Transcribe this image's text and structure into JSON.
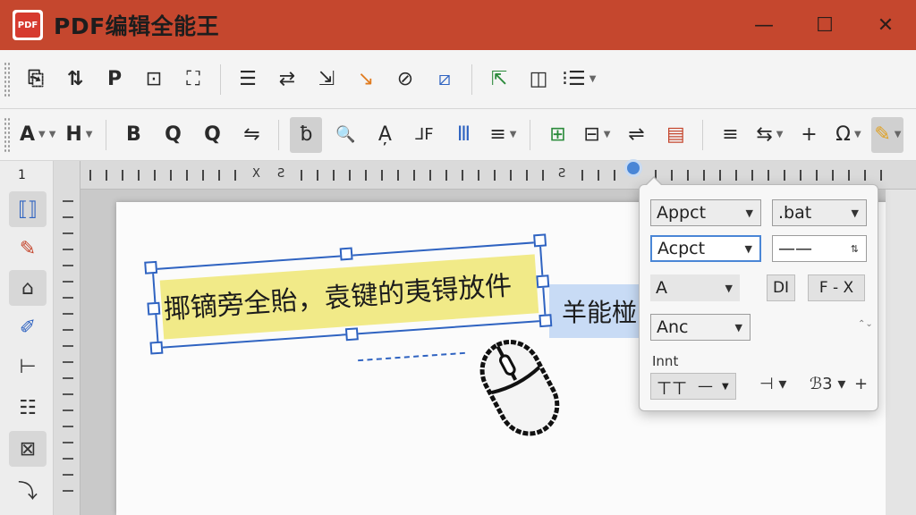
{
  "window": {
    "logo_text": "PDF",
    "title": "PDF编辑全能王",
    "minimize": "—",
    "maximize": "☐",
    "close": "✕"
  },
  "toolbar1": [
    "⎘",
    "⇅",
    "P",
    "⊡",
    "⛶",
    "☰",
    "⇄",
    "⇲",
    "↘",
    "⊘",
    "⧄",
    "⇱",
    "◫",
    "⁝☰"
  ],
  "toolbar2": {
    "font": "A",
    "heading": "H",
    "bold": "B",
    "find": "Q",
    "find2": "Q",
    "sym1": "⇋",
    "strike": "ƀ",
    "search": "🔍",
    "sym2": "A̦",
    "sym3": "⅃F",
    "sym4": "Ⅲ",
    "align": "≡",
    "sym5": "⊞",
    "sym6": "⊟",
    "sym7": "⇌",
    "sym8": "▤",
    "sym9": "≡",
    "sym10": "⇆",
    "plus": "+",
    "omega": "Ω",
    "pen": "✎"
  },
  "left_tools": {
    "page_num": "1",
    "items": [
      "⟦⟧",
      "✎",
      "⌂",
      "✐",
      "⊢",
      "☷",
      "⊠",
      "⤵"
    ]
  },
  "ruler": {
    "labels": [
      "X",
      "Ƨ",
      "Ƨ"
    ]
  },
  "document": {
    "edited_text": "揶镝旁全貽，袁键的夷锝放件",
    "next_text": "羊能椪"
  },
  "panel": {
    "font_field": "Appct",
    "ext_field": ".bat",
    "style_field": "Acpct",
    "line_field": "——",
    "line_icon": "⇅",
    "size_field": "A",
    "btn_di": "DI",
    "btn_f": "F - X",
    "anc_field": "Anc",
    "section_label": "Innt",
    "row_a": "ㄒㄒ",
    "row_b": "—",
    "row_c": "⊣ ▾",
    "row_d": "ℬ3 ▾",
    "row_e": "+"
  },
  "colors": {
    "titlebar": "#c5472e",
    "accent": "#2f63c1",
    "highlight": "#f1ea88",
    "selection": "#c8dbf5"
  }
}
